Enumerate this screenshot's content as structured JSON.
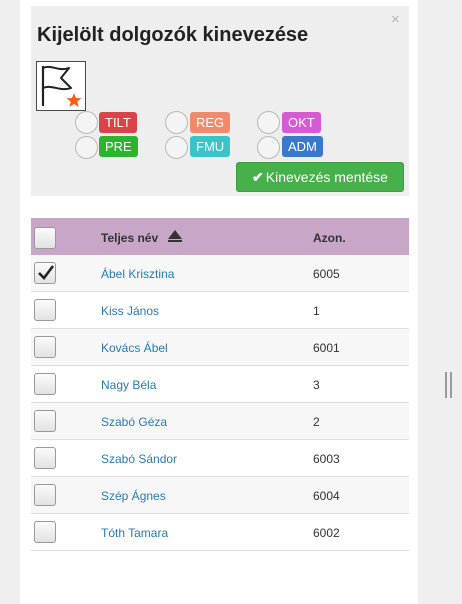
{
  "dialog": {
    "title": "Kijelölt dolgozók kinevezése",
    "close_label": "×",
    "save_label": "Kinevezés mentése",
    "save_icon": "check-icon",
    "flag_icon": "flag-icon",
    "star_icon": "star-icon"
  },
  "roles": [
    {
      "label": "TILT",
      "color": "#d9434a"
    },
    {
      "label": "REG",
      "color": "#ef8a6c"
    },
    {
      "label": "OKT",
      "color": "#d65ad4"
    },
    {
      "label": "PRE",
      "color": "#2fb32f"
    },
    {
      "label": "FMU",
      "color": "#3cc3c8"
    },
    {
      "label": "ADM",
      "color": "#3a78c9"
    }
  ],
  "table": {
    "headers": {
      "name": "Teljes név",
      "id": "Azon."
    },
    "sort": "ascending",
    "rows": [
      {
        "name": "Ábel Krisztina",
        "id": "6005",
        "checked": true
      },
      {
        "name": "Kiss János",
        "id": "1",
        "checked": false
      },
      {
        "name": "Kovács Ábel",
        "id": "6001",
        "checked": false
      },
      {
        "name": "Nagy Béla",
        "id": "3",
        "checked": false
      },
      {
        "name": "Szabó Géza",
        "id": "2",
        "checked": false
      },
      {
        "name": "Szabó Sándor",
        "id": "6003",
        "checked": false
      },
      {
        "name": "Szép Ágnes",
        "id": "6004",
        "checked": false
      },
      {
        "name": "Tóth Tamara",
        "id": "6002",
        "checked": false
      }
    ]
  }
}
